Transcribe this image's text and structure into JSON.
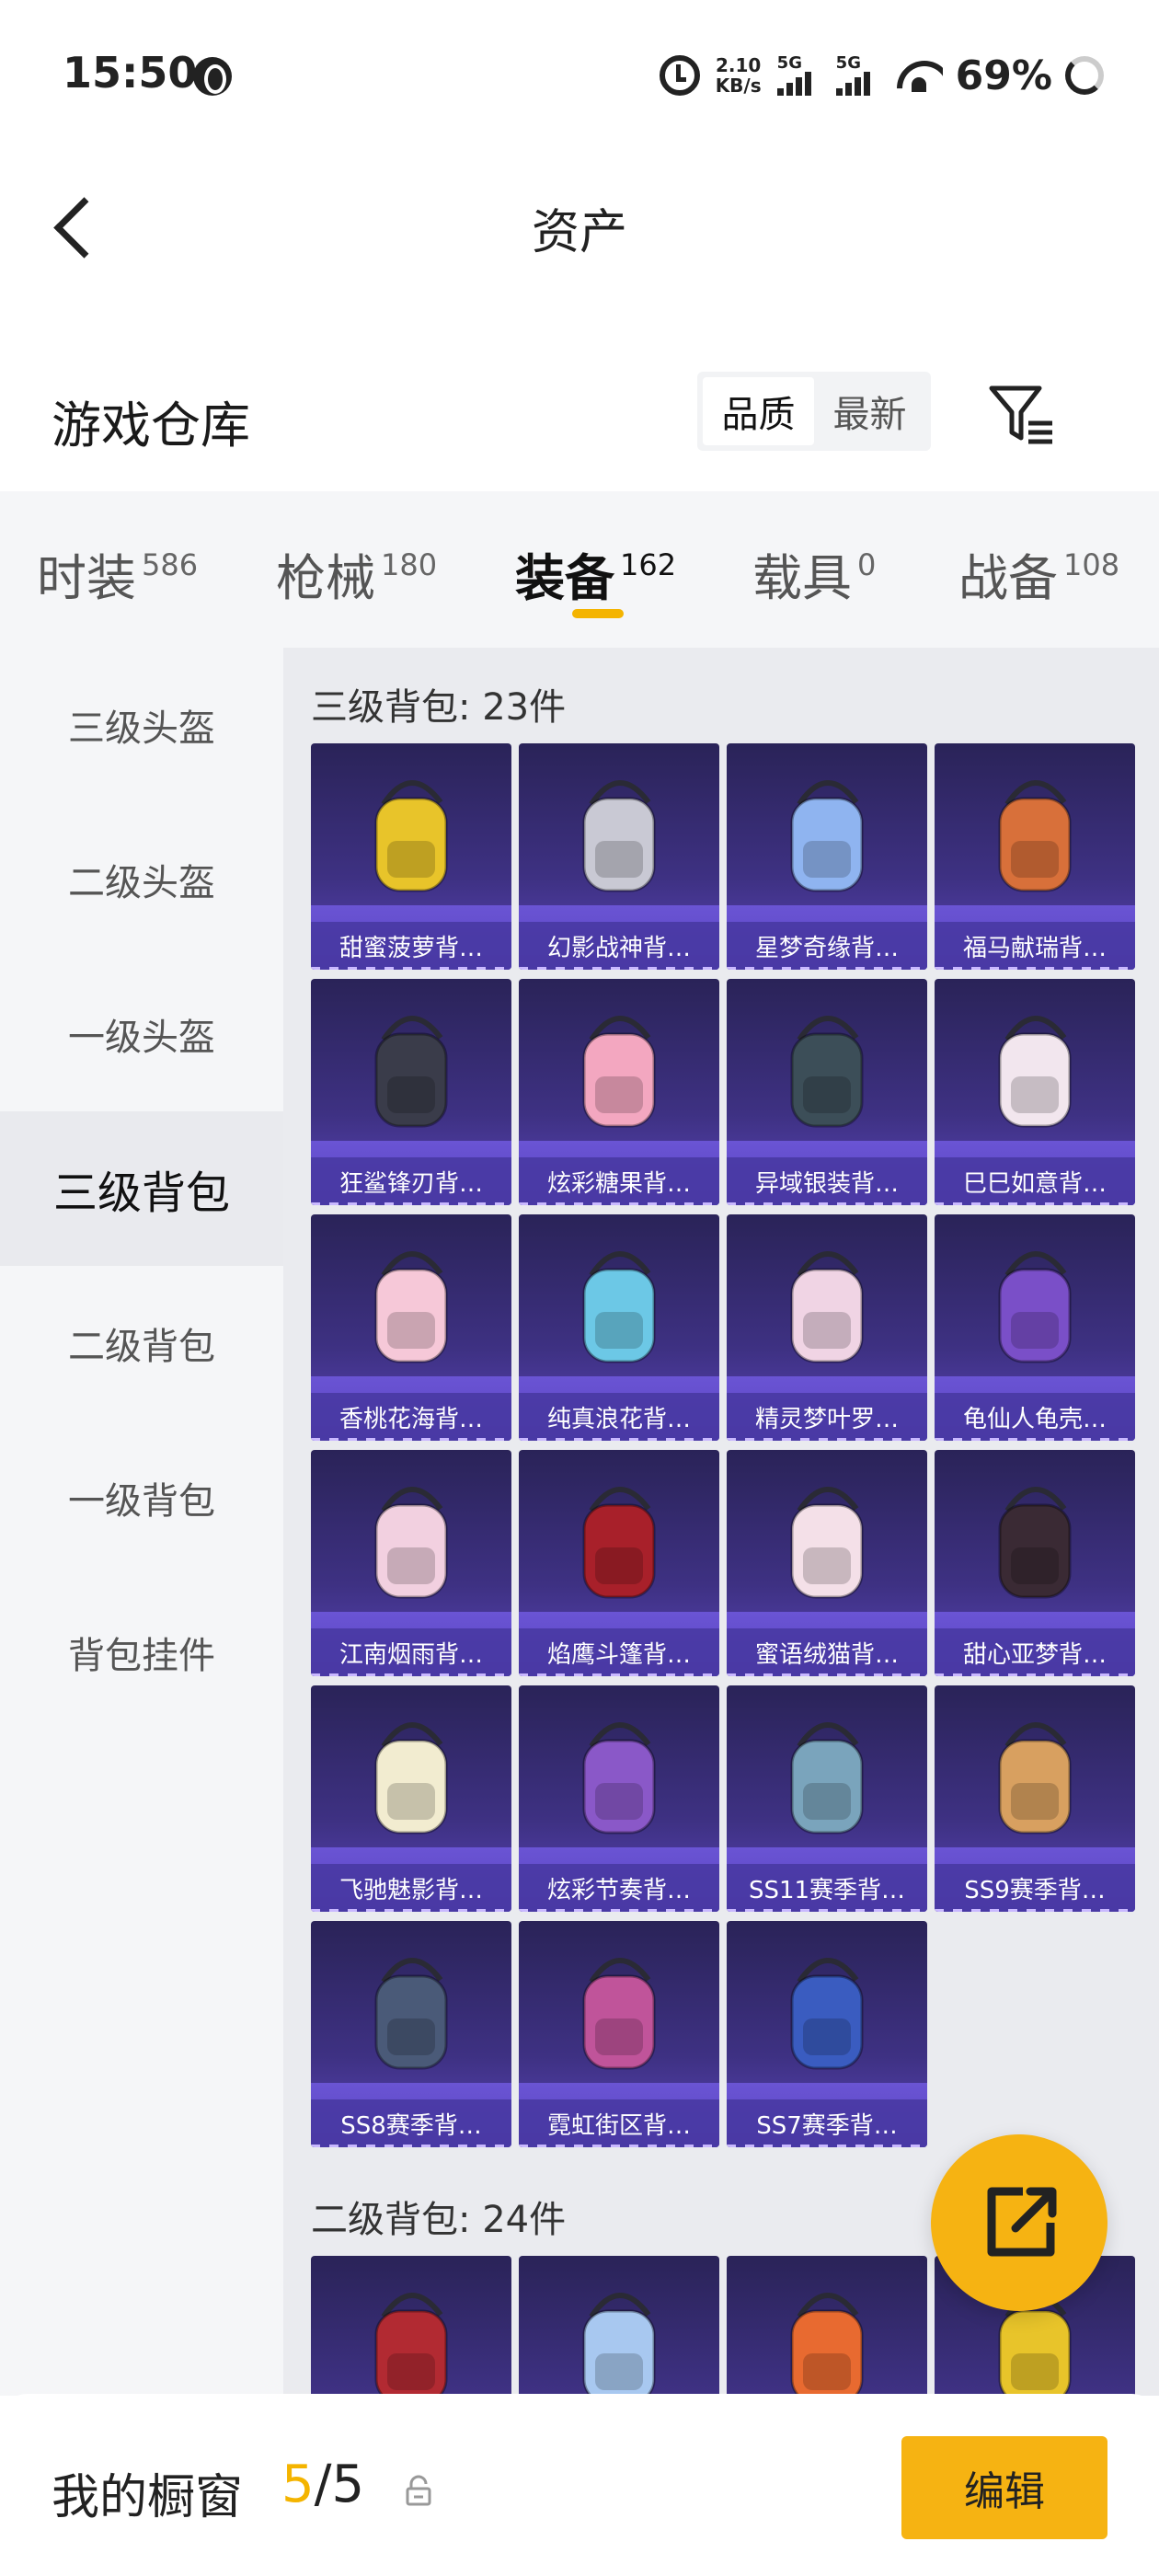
{
  "status_bar": {
    "time": "15:50",
    "net_speed_value": "2.10",
    "net_speed_unit": "KB/s",
    "sim1": "5G",
    "sim2": "5G",
    "battery": "69%"
  },
  "header": {
    "title": "资产",
    "back_icon": "chevron-left-icon"
  },
  "section": {
    "title": "游戏仓库",
    "sort_options": [
      {
        "label": "品质",
        "active": true
      },
      {
        "label": "最新",
        "active": false
      }
    ],
    "filter_icon": "filter-icon"
  },
  "tabs": [
    {
      "label": "时装",
      "count": "586",
      "active": false
    },
    {
      "label": "枪械",
      "count": "180",
      "active": false
    },
    {
      "label": "装备",
      "count": "162",
      "active": true
    },
    {
      "label": "载具",
      "count": "0",
      "active": false
    },
    {
      "label": "战备",
      "count": "108",
      "active": false
    }
  ],
  "sidebar": {
    "items": [
      {
        "label": "三级头盔",
        "active": false
      },
      {
        "label": "二级头盔",
        "active": false
      },
      {
        "label": "一级头盔",
        "active": false
      },
      {
        "label": "三级背包",
        "active": true
      },
      {
        "label": "二级背包",
        "active": false
      },
      {
        "label": "一级背包",
        "active": false
      },
      {
        "label": "背包挂件",
        "active": false
      }
    ]
  },
  "groups": [
    {
      "title": "三级背包: 23件",
      "items": [
        {
          "name": "甜蜜菠萝背…",
          "color": "#e8c42a"
        },
        {
          "name": "幻影战神背…",
          "color": "#c9c9d4"
        },
        {
          "name": "星梦奇缘背…",
          "color": "#8fb4f0"
        },
        {
          "name": "福马献瑞背…",
          "color": "#d8703a"
        },
        {
          "name": "狂鲨锋刃背…",
          "color": "#3a3c4a"
        },
        {
          "name": "炫彩糖果背…",
          "color": "#f3a7c0"
        },
        {
          "name": "异域银装背…",
          "color": "#3c4e58"
        },
        {
          "name": "巳巳如意背…",
          "color": "#f2e6ee"
        },
        {
          "name": "香桃花海背…",
          "color": "#f6c8d8"
        },
        {
          "name": "纯真浪花背…",
          "color": "#6cc8e6"
        },
        {
          "name": "精灵梦叶罗…",
          "color": "#f0d4e4"
        },
        {
          "name": "龟仙人龟壳…",
          "color": "#7a4fc8"
        },
        {
          "name": "江南烟雨背…",
          "color": "#f2d0e0"
        },
        {
          "name": "焰鹰斗篷背…",
          "color": "#a8202a"
        },
        {
          "name": "蜜语绒猫背…",
          "color": "#f4e0e8"
        },
        {
          "name": "甜心亚梦背…",
          "color": "#3a2a34"
        },
        {
          "name": "飞驰魅影背…",
          "color": "#f2ecd0"
        },
        {
          "name": "炫彩节奏背…",
          "color": "#8a58c8"
        },
        {
          "name": "SS11赛季背…",
          "color": "#7aa4bc"
        },
        {
          "name": "SS9赛季背…",
          "color": "#d8a060"
        },
        {
          "name": "SS8赛季背…",
          "color": "#4a5a78"
        },
        {
          "name": "霓虹街区背…",
          "color": "#c0549a"
        },
        {
          "name": "SS7赛季背…",
          "color": "#3a5cc0"
        }
      ]
    },
    {
      "title": "二级背包: 24件",
      "items": [
        {
          "name": "",
          "color": "#b22a32"
        },
        {
          "name": "",
          "color": "#a8c8f0"
        },
        {
          "name": "",
          "color": "#e86a30"
        },
        {
          "name": "",
          "color": "#e8c42a"
        }
      ]
    }
  ],
  "fab": {
    "icon": "share-icon"
  },
  "bottom_bar": {
    "label": "我的橱窗",
    "count_current": "5",
    "count_sep": "/",
    "count_total": "5",
    "lock_icon": "lock-icon",
    "edit_label": "编辑"
  },
  "colors": {
    "accent": "#f4b400",
    "card_bg": "#3e3183"
  }
}
